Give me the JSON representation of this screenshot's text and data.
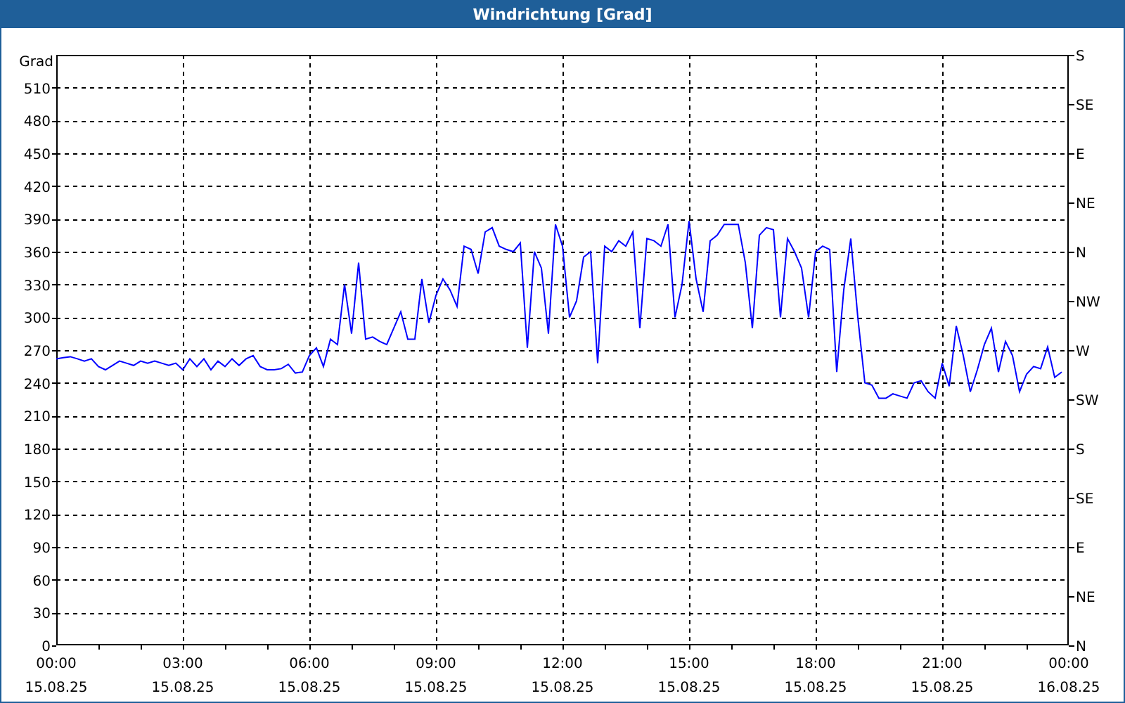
{
  "window": {
    "title": "Windrichtung [Grad]"
  },
  "chart": {
    "chart_data": {
      "type": "line",
      "grid": true,
      "ylabel": "Grad",
      "ylim": [
        0,
        540
      ],
      "yticks": [
        0,
        30,
        60,
        90,
        120,
        150,
        180,
        210,
        240,
        270,
        300,
        330,
        360,
        390,
        420,
        450,
        480,
        510
      ],
      "categories": [
        "00:00\n15.08.25",
        null,
        null,
        null,
        null,
        null,
        null,
        null,
        null,
        null,
        null,
        null,
        null,
        null,
        null,
        null,
        null,
        null,
        "03:00\n15.08.25",
        null,
        null,
        null,
        null,
        null,
        null,
        null,
        null,
        null,
        null,
        null,
        null,
        null,
        null,
        null,
        null,
        null,
        "06:00\n15.08.25",
        null,
        null,
        null,
        null,
        null,
        null,
        null,
        null,
        null,
        null,
        null,
        null,
        null,
        null,
        null,
        null,
        null,
        "09:00\n15.08.25",
        null,
        null,
        null,
        null,
        null,
        null,
        null,
        null,
        null,
        null,
        null,
        null,
        null,
        null,
        null,
        null,
        null,
        "12:00\n15.08.25",
        null,
        null,
        null,
        null,
        null,
        null,
        null,
        null,
        null,
        null,
        null,
        null,
        null,
        null,
        null,
        null,
        null,
        "15:00\n15.08.25",
        null,
        null,
        null,
        null,
        null,
        null,
        null,
        null,
        null,
        null,
        null,
        null,
        null,
        null,
        null,
        null,
        null,
        "18:00\n15.08.25",
        null,
        null,
        null,
        null,
        null,
        null,
        null,
        null,
        null,
        null,
        null,
        null,
        null,
        null,
        null,
        null,
        null,
        "21:00\n15.08.25",
        null,
        null,
        null,
        null,
        null,
        null,
        null,
        null,
        null,
        null,
        null,
        null,
        null,
        null,
        null,
        null,
        null,
        "00:00\n16.08.25"
      ],
      "series": [
        {
          "color": "#0000ff",
          "values": [
            262,
            263,
            264,
            262,
            260,
            262,
            255,
            252,
            256,
            260,
            258,
            256,
            260,
            258,
            260,
            258,
            256,
            258,
            252,
            262,
            255,
            262,
            252,
            260,
            255,
            262,
            256,
            262,
            265,
            255,
            252,
            252,
            253,
            257,
            249,
            250,
            265,
            272,
            255,
            280,
            275,
            330,
            285,
            350,
            280,
            282,
            278,
            275,
            290,
            305,
            280,
            280,
            335,
            295,
            320,
            335,
            325,
            310,
            365,
            362,
            340,
            378,
            382,
            365,
            362,
            360,
            368,
            272,
            360,
            345,
            285,
            385,
            365,
            300,
            315,
            355,
            360,
            258,
            365,
            360,
            370,
            365,
            378,
            290,
            372,
            370,
            365,
            385,
            300,
            330,
            388,
            335,
            305,
            370,
            375,
            385,
            385,
            385,
            350,
            290,
            375,
            382,
            380,
            300,
            372,
            360,
            345,
            300,
            360,
            365,
            362,
            250,
            325,
            372,
            300,
            240,
            238,
            226,
            226,
            230,
            228,
            226,
            240,
            242,
            232,
            226,
            258,
            237,
            292,
            265,
            232,
            252,
            275,
            290,
            250,
            278,
            265,
            232,
            248,
            255,
            253,
            273,
            245,
            250,
            null
          ]
        }
      ]
    },
    "right_axis": {
      "labels": [
        "S",
        "SE",
        "E",
        "NE",
        "N",
        "NW",
        "W",
        "SW",
        "S",
        "SE",
        "E",
        "NE",
        "N"
      ]
    }
  }
}
